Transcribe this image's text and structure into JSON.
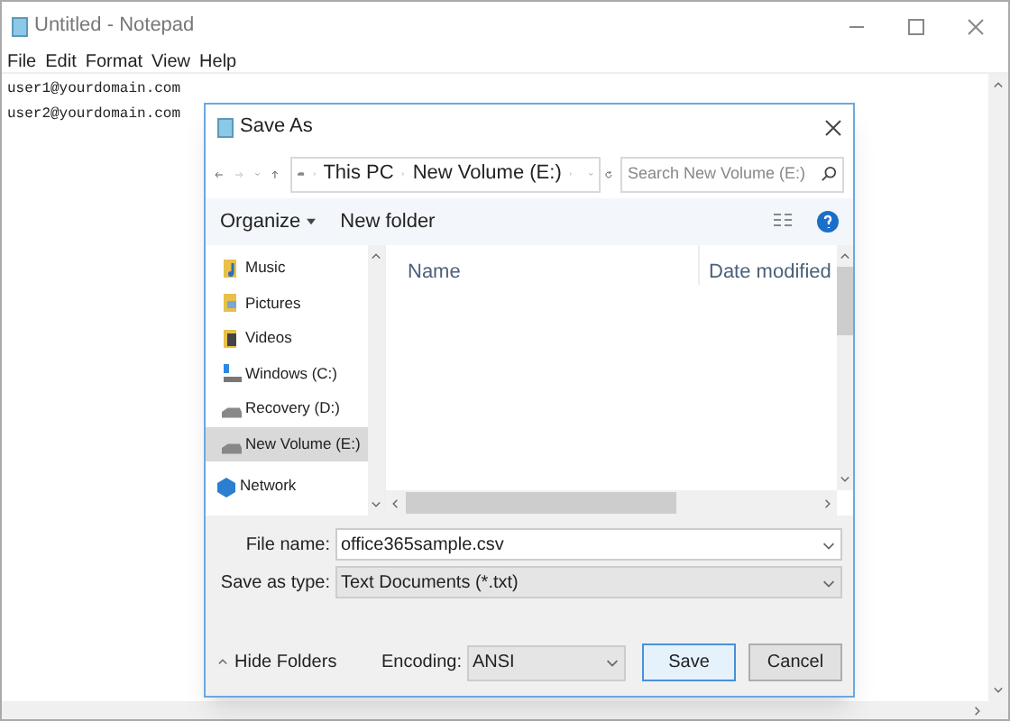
{
  "notepad": {
    "title": "Untitled - Notepad",
    "menu": [
      "File",
      "Edit",
      "Format",
      "View",
      "Help"
    ],
    "lines": [
      "user1@yourdomain.com",
      "user2@yourdomain.com"
    ]
  },
  "dialog": {
    "title": "Save As",
    "breadcrumb": [
      "This PC",
      "New Volume (E:)"
    ],
    "search": {
      "placeholder": "Search New Volume (E:)"
    },
    "toolbar": {
      "organize": "Organize",
      "new_folder": "New folder"
    },
    "nav_items": [
      {
        "label": "Music",
        "kind": "music",
        "selected": false
      },
      {
        "label": "Pictures",
        "kind": "pictures",
        "selected": false
      },
      {
        "label": "Videos",
        "kind": "videos",
        "selected": false
      },
      {
        "label": "Windows (C:)",
        "kind": "system-drive",
        "selected": false
      },
      {
        "label": "Recovery (D:)",
        "kind": "drive",
        "selected": false
      },
      {
        "label": "New Volume (E:)",
        "kind": "drive",
        "selected": true
      },
      {
        "label": "Network",
        "kind": "network",
        "selected": false
      }
    ],
    "columns": [
      "Name",
      "Date modified"
    ],
    "file_name": {
      "label": "File name:",
      "value": "office365sample.csv"
    },
    "save_as_type": {
      "label": "Save as type:",
      "value": "Text Documents (*.txt)"
    },
    "hide_folders": "Hide Folders",
    "encoding": {
      "label": "Encoding:",
      "value": "ANSI"
    },
    "buttons": [
      "Save",
      "Cancel"
    ]
  }
}
